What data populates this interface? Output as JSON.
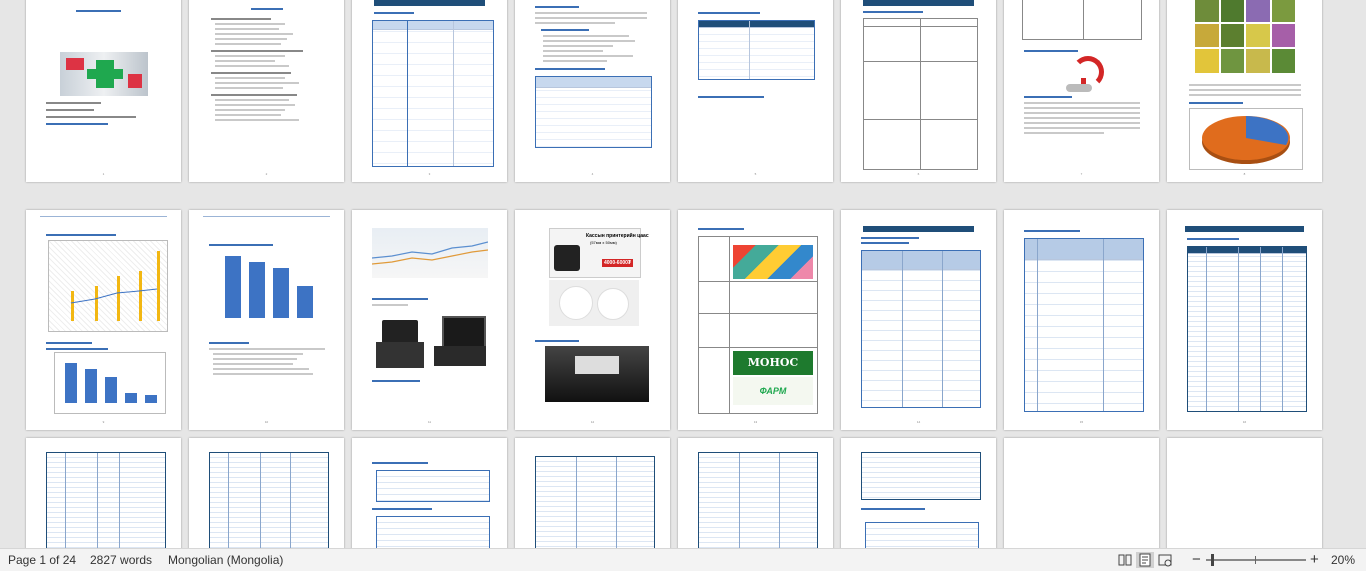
{
  "status_bar": {
    "page_info": "Page 1 of 24",
    "word_count": "2827 words",
    "language": "Mongolian (Mongolia)",
    "zoom_label": "20%",
    "zoom_minus": "−",
    "zoom_plus": "+",
    "zoom_level_percent": 20
  },
  "view_buttons": [
    {
      "name": "read-mode-icon",
      "active": false
    },
    {
      "name": "print-layout-icon",
      "active": true
    },
    {
      "name": "web-layout-icon",
      "active": false
    }
  ],
  "colors": {
    "accent_blue": "#3b6fb5",
    "dark_blue": "#1f4e79",
    "bar_yellow": "#f2b712",
    "pie_orange": "#e06c1d",
    "pie_blue": "#3d73c4",
    "green_logo": "#1fa84f"
  },
  "page_labels": {
    "p4_logo_main": "МОНОС",
    "p4_logo_sub": "ФАРМ",
    "p2_receipt_title": "Кассын принтерийн цаас",
    "p2_receipt_sub": "(57мм x 50мм)",
    "p2_price": "4000-6000₮"
  }
}
